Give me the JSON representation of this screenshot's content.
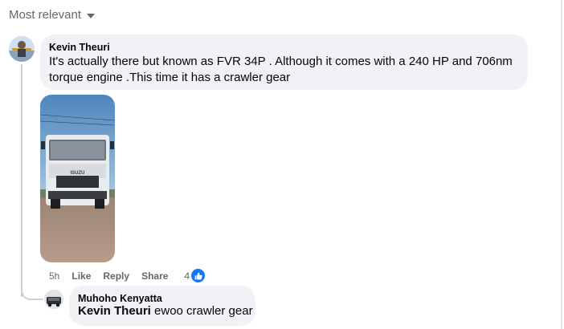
{
  "sort": {
    "label": "Most relevant"
  },
  "comment": {
    "author": "Kevin Theuri",
    "text": "It's actually there but known as FVR 34P . Although it comes with a 240 HP and 706nm torque engine .This time it has a crawler gear",
    "actions": {
      "time": "5h",
      "like": "Like",
      "reply": "Reply",
      "share": "Share",
      "reaction_count": "4"
    },
    "photo": {
      "badge": "ISUZU"
    }
  },
  "reply": {
    "author": "Muhoho Kenyatta",
    "mention": "Kevin Theuri",
    "text": " ewoo crawler gear"
  },
  "colors": {
    "bubble": "#f0f2f5",
    "meta": "#65676b",
    "like": "#1877f2"
  }
}
